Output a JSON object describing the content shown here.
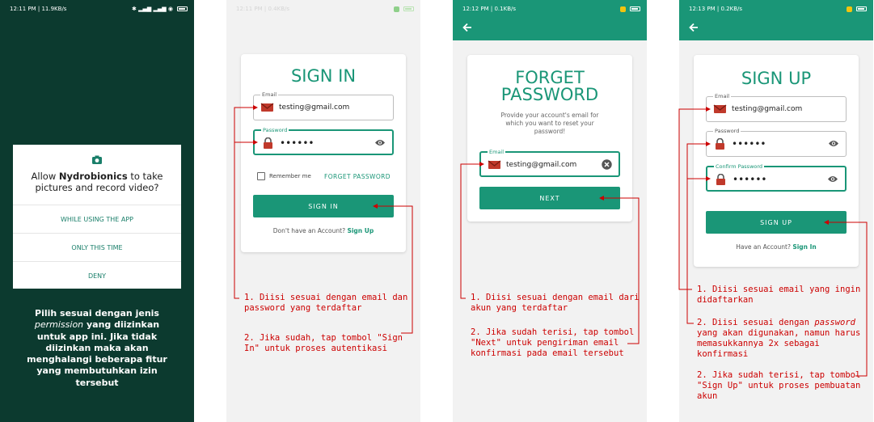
{
  "panel1": {
    "status": {
      "time": "12:11 PM | 11.9KB/s",
      "icons": "✱ ▂▄▆ ▂▄▆ ◉"
    },
    "dialog": {
      "q_pre": "Allow ",
      "app": "Nydrobionics",
      "q_post": " to take pictures and record video?",
      "options": [
        "WHILE USING THE APP",
        "ONLY THIS TIME",
        "DENY"
      ]
    },
    "caption_a": "Pilih sesuai dengan jenis ",
    "caption_em": "permission",
    "caption_b": " yang diizinkan untuk app ini. Jika tidak diizinkan maka akan menghalangi beberapa fitur yang membutuhkan izin tersebut"
  },
  "panel2": {
    "status": {
      "time": "12:11 PM | 0.4KB/s"
    },
    "title": "SIGN IN",
    "email_label": "Email",
    "email_value": "testing@gmail.com",
    "password_label": "Password",
    "password_value": "••••••",
    "remember": "Remember me",
    "forget": "FORGET PASSWORD",
    "button": "SIGN IN",
    "footer_text": "Don't have an Account?",
    "footer_link": "Sign Up",
    "notes": [
      "1. Diisi sesuai dengan email dan password yang terdaftar",
      "2. Jika sudah, tap tombol \"Sign In\" untuk proses autentikasi"
    ]
  },
  "panel3": {
    "status": {
      "time": "12:12 PM | 0.1KB/s"
    },
    "title": "FORGET PASSWORD",
    "subtitle": "Provide your account's email for which you want to reset your password!",
    "email_label": "Email",
    "email_value": "testing@gmail.com",
    "button": "NEXT",
    "notes": [
      "1. Diisi sesuai dengan email dari akun yang terdaftar",
      "2. Jika sudah terisi, tap tombol \"Next\" untuk pengiriman email konfirmasi pada email tersebut"
    ]
  },
  "panel4": {
    "status": {
      "time": "12:13 PM | 0.2KB/s"
    },
    "title": "SIGN UP",
    "email_label": "Email",
    "email_value": "testing@gmail.com",
    "password_label": "Password",
    "password_value": "••••••",
    "confirm_label": "Confirm Password",
    "confirm_value": "••••••",
    "button": "SIGN UP",
    "footer_text": "Have an Account?",
    "footer_link": "Sign In",
    "note1": "1. Diisi sesuai email yang ingin didaftarkan",
    "note2_a": "2. Diisi sesuai dengan ",
    "note2_em": "password",
    "note2_b": " yang akan digunakan, namun harus memasukkannya 2x sebagai konfirmasi",
    "note3": "2. Jika sudah terisi, tap tombol \"Sign Up\" untuk proses pembuatan akun"
  },
  "colors": {
    "primary": "#1a9677",
    "dark_bg": "#0c3a2f",
    "annotation": "#cc0000",
    "screen_bg": "#f2f2f2"
  },
  "icons": [
    "camera-icon",
    "mail-icon",
    "lock-icon",
    "eye-icon",
    "clear-icon",
    "arrow-left-icon",
    "battery-icon"
  ]
}
